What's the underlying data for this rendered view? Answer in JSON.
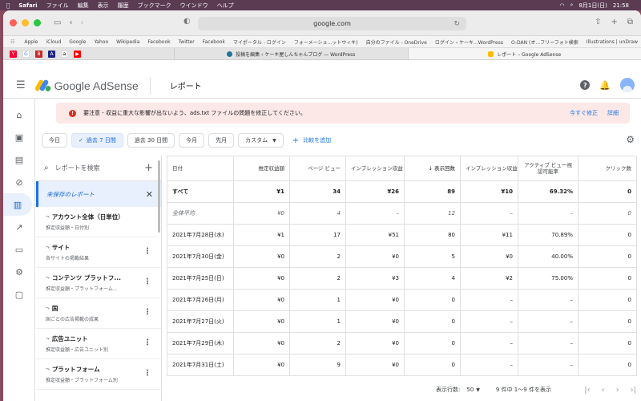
{
  "menubar": {
    "app": "Safari",
    "items": [
      "ファイル",
      "編集",
      "表示",
      "履歴",
      "ブックマーク",
      "ウインドウ",
      "ヘルプ"
    ],
    "date": "8月1日(日)",
    "time": "21:58"
  },
  "browser": {
    "url": "google.com"
  },
  "bookmarks": [
    "Apple",
    "iCloud",
    "Google",
    "Yahoo",
    "Wikipedia",
    "Facebook",
    "Twitter",
    "Facebook",
    "マイポータル - ログイン",
    "フォーメーショ...ットウィキ)",
    "自分のファイル - OneDrive",
    "ログイン ‹ ケーキ...WordPress",
    "O-DAN (オ...フリーフォト検索",
    "Illustrations | unDraw"
  ],
  "tabs": [
    {
      "label": "投稿を編集 ‹ ケーキ屋しんちゃんブログ — WordPress"
    },
    {
      "label": "レポート – Google AdSense"
    }
  ],
  "header": {
    "logo": "Google AdSense",
    "title": "レポート"
  },
  "alert": {
    "message": "要注意 - 収益に重大な影響が出ないよう、ads.txt ファイルの問題を修正してください。",
    "fix": "今すぐ修正",
    "details": "詳細"
  },
  "filters": {
    "chips": [
      "今日",
      "過去 7 日間",
      "過去 30 日間",
      "今月",
      "先月"
    ],
    "custom": "カスタム",
    "compare": "比較を追加"
  },
  "sidebar": {
    "search_placeholder": "レポートを検索",
    "unsaved": "未保存のレポート",
    "items": [
      {
        "title": "アカウント全体（日単位）",
        "subtitle": "推定収益額・日付別"
      },
      {
        "title": "サイト",
        "subtitle": "各サイトの掲載結果"
      },
      {
        "title": "コンテンツ プラットフ...",
        "subtitle": "推定収益額・プラットフォーム..."
      },
      {
        "title": "国",
        "subtitle": "国ごとの広告掲載の成果"
      },
      {
        "title": "広告ユニット",
        "subtitle": "推定収益額・広告ユニット別"
      },
      {
        "title": "プラットフォーム",
        "subtitle": "推定収益額・プラットフォーム別"
      }
    ]
  },
  "table": {
    "headers": [
      "日付",
      "推定収益額",
      "ページ ビュー",
      "インプレッション収益",
      "表示回数",
      "インプレッション収益",
      "アクティブ ビュー視認可能率",
      "クリック数"
    ],
    "rows": [
      {
        "type": "total",
        "cells": [
          "すべて",
          "¥1",
          "34",
          "¥26",
          "89",
          "¥10",
          "69.32%",
          "0"
        ]
      },
      {
        "type": "avg",
        "cells": [
          "全体平均",
          "¥0",
          "4",
          "–",
          "12",
          "–",
          "–",
          "0"
        ]
      },
      {
        "type": "row",
        "cells": [
          "2021年7月28日(水)",
          "¥1",
          "17",
          "¥51",
          "80",
          "¥11",
          "70.89%",
          "0"
        ]
      },
      {
        "type": "row",
        "cells": [
          "2021年7月30日(金)",
          "¥0",
          "2",
          "¥0",
          "5",
          "¥0",
          "40.00%",
          "0"
        ]
      },
      {
        "type": "row",
        "cells": [
          "2021年7月25日(日)",
          "¥0",
          "2",
          "¥3",
          "4",
          "¥2",
          "75.00%",
          "0"
        ]
      },
      {
        "type": "row",
        "cells": [
          "2021年7月26日(月)",
          "¥0",
          "1",
          "¥0",
          "0",
          "–",
          "–",
          "0"
        ]
      },
      {
        "type": "row",
        "cells": [
          "2021年7月27日(火)",
          "¥0",
          "1",
          "¥0",
          "0",
          "–",
          "–",
          "0"
        ]
      },
      {
        "type": "row",
        "cells": [
          "2021年7月29日(木)",
          "¥0",
          "2",
          "¥0",
          "0",
          "–",
          "–",
          "0"
        ]
      },
      {
        "type": "row",
        "cells": [
          "2021年7月31日(土)",
          "¥0",
          "9",
          "¥0",
          "0",
          "–",
          "–",
          "0"
        ]
      }
    ]
  },
  "pager": {
    "rows_label": "表示行数:",
    "rows_value": "50",
    "range": "9 件中 1〜9 件を表示"
  }
}
